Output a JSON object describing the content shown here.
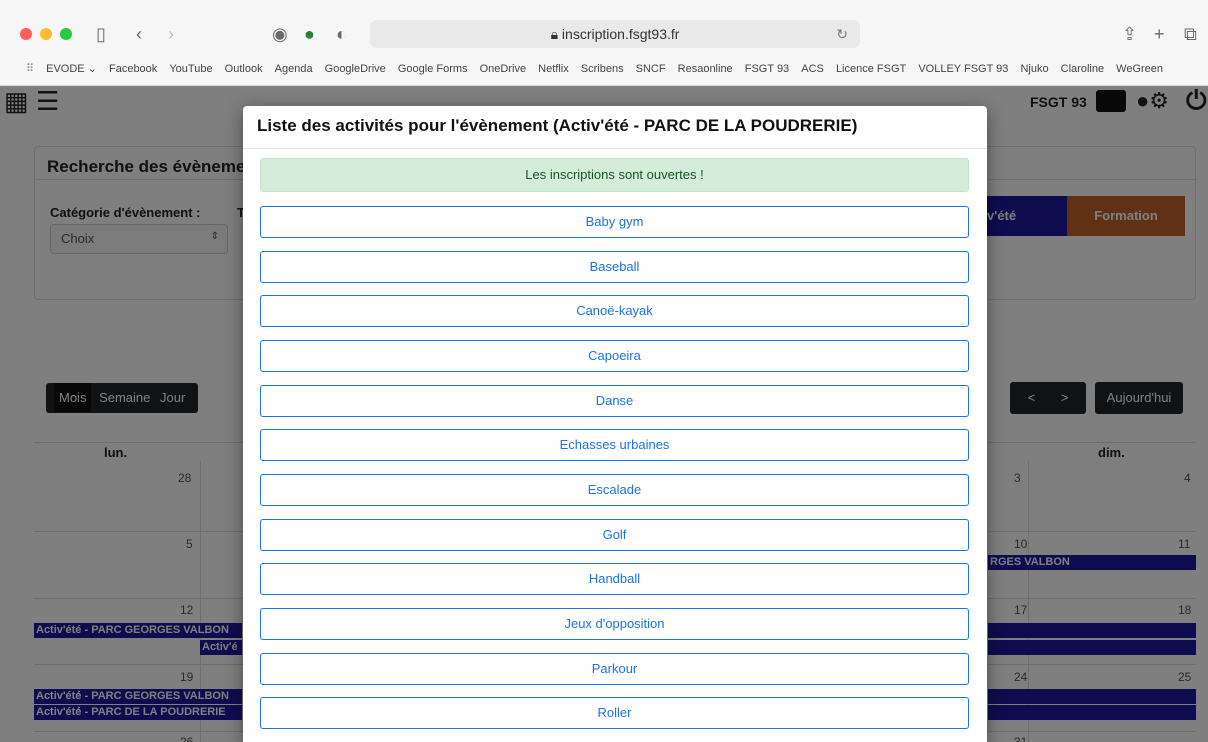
{
  "browser": {
    "url": "inscription.fsgt93.fr",
    "bookmarks": [
      "EVODE ⌄",
      "Facebook",
      "YouTube",
      "Outlook",
      "Agenda",
      "GoogleDrive",
      "Google Forms",
      "OneDrive",
      "Netflix",
      "Scribens",
      "SNCF",
      "Resaonline",
      "FSGT 93",
      "ACS",
      "Licence FSGT",
      "VOLLEY FSGT 93",
      "Njuko",
      "Claroline",
      "WeGreen"
    ]
  },
  "nav": {
    "brand": "FSGT 93"
  },
  "search_card": {
    "title": "Recherche des évènemen",
    "category_label": "Catégorie d'évènement :",
    "category_value": "Choix",
    "t_label": "T",
    "tag_activete": "v'été",
    "tag_formation": "Formation"
  },
  "calendar": {
    "views": [
      "Mois",
      "Semaine",
      "Jour"
    ],
    "today_button": "Aujourd'hui",
    "prev": "<",
    "next": ">",
    "days_left": "lun.",
    "days_right": "dim.",
    "left_numbers": [
      "28",
      "5",
      "12",
      "19",
      "26"
    ],
    "mid_numbers": [
      "3",
      "10",
      "17",
      "24",
      "31"
    ],
    "right_numbers": [
      "4",
      "11",
      "18",
      "25"
    ],
    "events": {
      "valbon_full": "Activ'été - PARC GEORGES VALBON",
      "valbon_short": "Activ'é",
      "valbon_tail": "RGES VALBON",
      "poudrerie": "Activ'été - PARC DE LA POUDRERIE"
    }
  },
  "modal": {
    "title": "Liste des activités pour l'évènement (Activ'été - PARC DE LA POUDRERIE)",
    "alert": "Les inscriptions sont ouvertes !",
    "activities": [
      "Baby gym",
      "Baseball",
      "Canoë-kayak",
      "Capoeira",
      "Danse",
      "Echasses urbaines",
      "Escalade",
      "Golf",
      "Handball",
      "Jeux d'opposition",
      "Parkour",
      "Roller"
    ]
  },
  "colors": {
    "event": "#1f169f",
    "formation": "#c0622b",
    "link": "#1a73e8",
    "alert_bg": "#d4edda"
  }
}
